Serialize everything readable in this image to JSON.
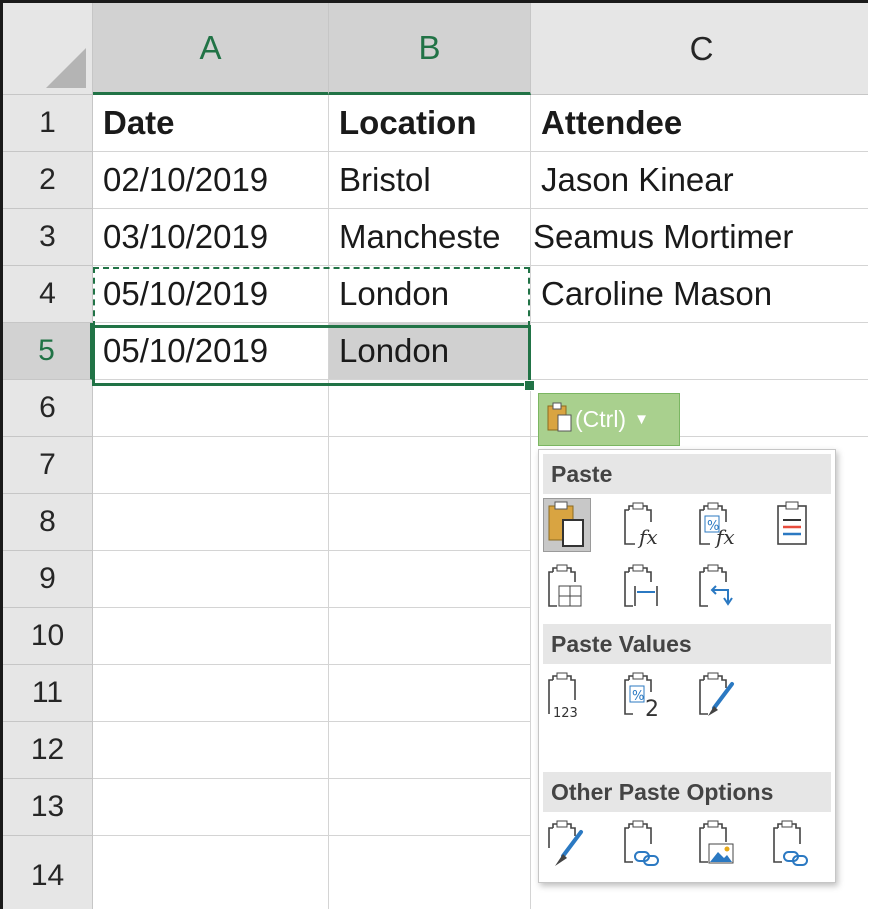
{
  "sheet": {
    "columns": [
      "A",
      "B",
      "C"
    ],
    "rows": [
      "1",
      "2",
      "3",
      "4",
      "5",
      "6",
      "7",
      "8",
      "9",
      "10",
      "11",
      "12",
      "13",
      "14"
    ],
    "cells": {
      "A1": "Date",
      "B1": "Location",
      "C1": "Attendee",
      "A2": "02/10/2019",
      "B2": "Bristol",
      "C2": "Jason Kinear",
      "A3": "03/10/2019",
      "B3": "Mancheste",
      "C3": "Seamus Mortimer",
      "A4": "05/10/2019",
      "B4": "London",
      "C4": "Caroline Mason",
      "A5": "05/10/2019",
      "B5": "London"
    }
  },
  "paste_button": {
    "label": "(Ctrl)",
    "icon": "clipboard-icon"
  },
  "paste_menu": {
    "sections": [
      {
        "title": "Paste",
        "options": [
          "paste-icon",
          "paste-formulas-icon",
          "paste-formulas-number-formatting-icon",
          "keep-source-formatting-icon",
          "no-borders-icon",
          "keep-column-widths-icon",
          "transpose-icon"
        ]
      },
      {
        "title": "Paste Values",
        "options": [
          "values-icon",
          "values-number-formatting-icon",
          "values-source-formatting-icon"
        ]
      },
      {
        "title": "Other Paste Options",
        "options": [
          "formatting-icon",
          "paste-link-icon",
          "picture-icon",
          "linked-picture-icon"
        ]
      }
    ],
    "formula_glyph": "fx",
    "percent_glyph": "%",
    "values_glyph": "123",
    "number_glyph": "2"
  },
  "colors": {
    "accent": "#217346",
    "ctrl_button": "#a9d08e",
    "selected_row": "#d0d0d0"
  }
}
